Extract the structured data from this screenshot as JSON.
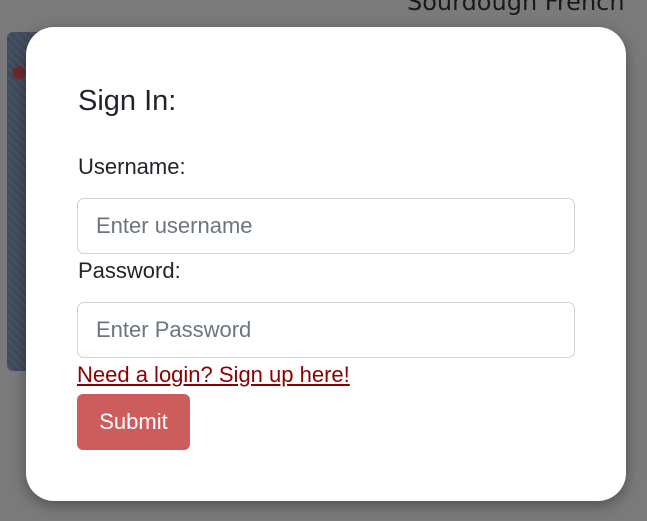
{
  "background": {
    "page_title": "Sourdough French"
  },
  "signin": {
    "title": "Sign In:",
    "username_label": "Username:",
    "username_placeholder": "Enter username",
    "username_value": "",
    "password_label": "Password:",
    "password_placeholder": "Enter Password",
    "password_value": "",
    "signup_link": "Need a login? Sign up here!",
    "submit_label": "Submit"
  },
  "colors": {
    "overlay": "#7a7a7a",
    "modal_background": "#ffffff",
    "link": "#8b0000",
    "submit_button": "#cd5c5c",
    "input_border": "#ced4da",
    "placeholder": "#6c757d"
  }
}
